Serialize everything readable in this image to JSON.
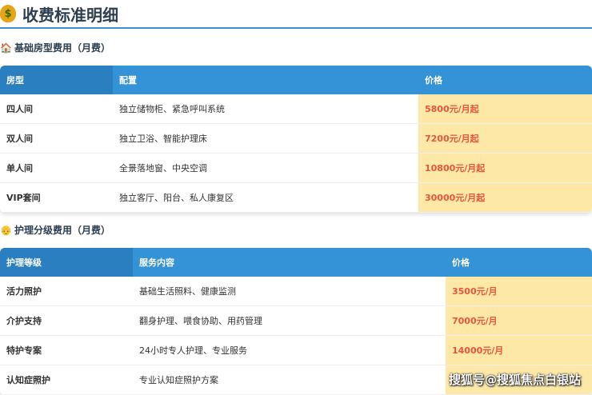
{
  "title": "收费标准明细",
  "section1": {
    "heading": "基础房型费用（月费）",
    "headers": [
      "房型",
      "配置",
      "价格"
    ],
    "rows": [
      {
        "name": "四人间",
        "config": "独立储物柜、紧急呼叫系统",
        "price": "5800元/月起"
      },
      {
        "name": "双人间",
        "config": "独立卫浴、智能护理床",
        "price": "7200元/月起"
      },
      {
        "name": "单人间",
        "config": "全景落地窗、中央空调",
        "price": "10800元/月起"
      },
      {
        "name": "VIP套间",
        "config": "独立客厅、阳台、私人康复区",
        "price": "30000元/月起"
      }
    ]
  },
  "section2": {
    "heading": "护理分级费用（月费）",
    "headers": [
      "护理等级",
      "服务内容",
      "价格"
    ],
    "rows": [
      {
        "name": "活力照护",
        "config": "基础生活照料、健康监测",
        "price": "3500元/月"
      },
      {
        "name": "介护支持",
        "config": "翻身护理、喂食协助、用药管理",
        "price": "7000元/月"
      },
      {
        "name": "特护专案",
        "config": "24小时专人护理、专业服务",
        "price": "14000元/月"
      },
      {
        "name": "认知症照护",
        "config": "专业认知症照护方案",
        "price": ""
      }
    ]
  },
  "watermark": "搜狐号@搜狐焦点白银站"
}
